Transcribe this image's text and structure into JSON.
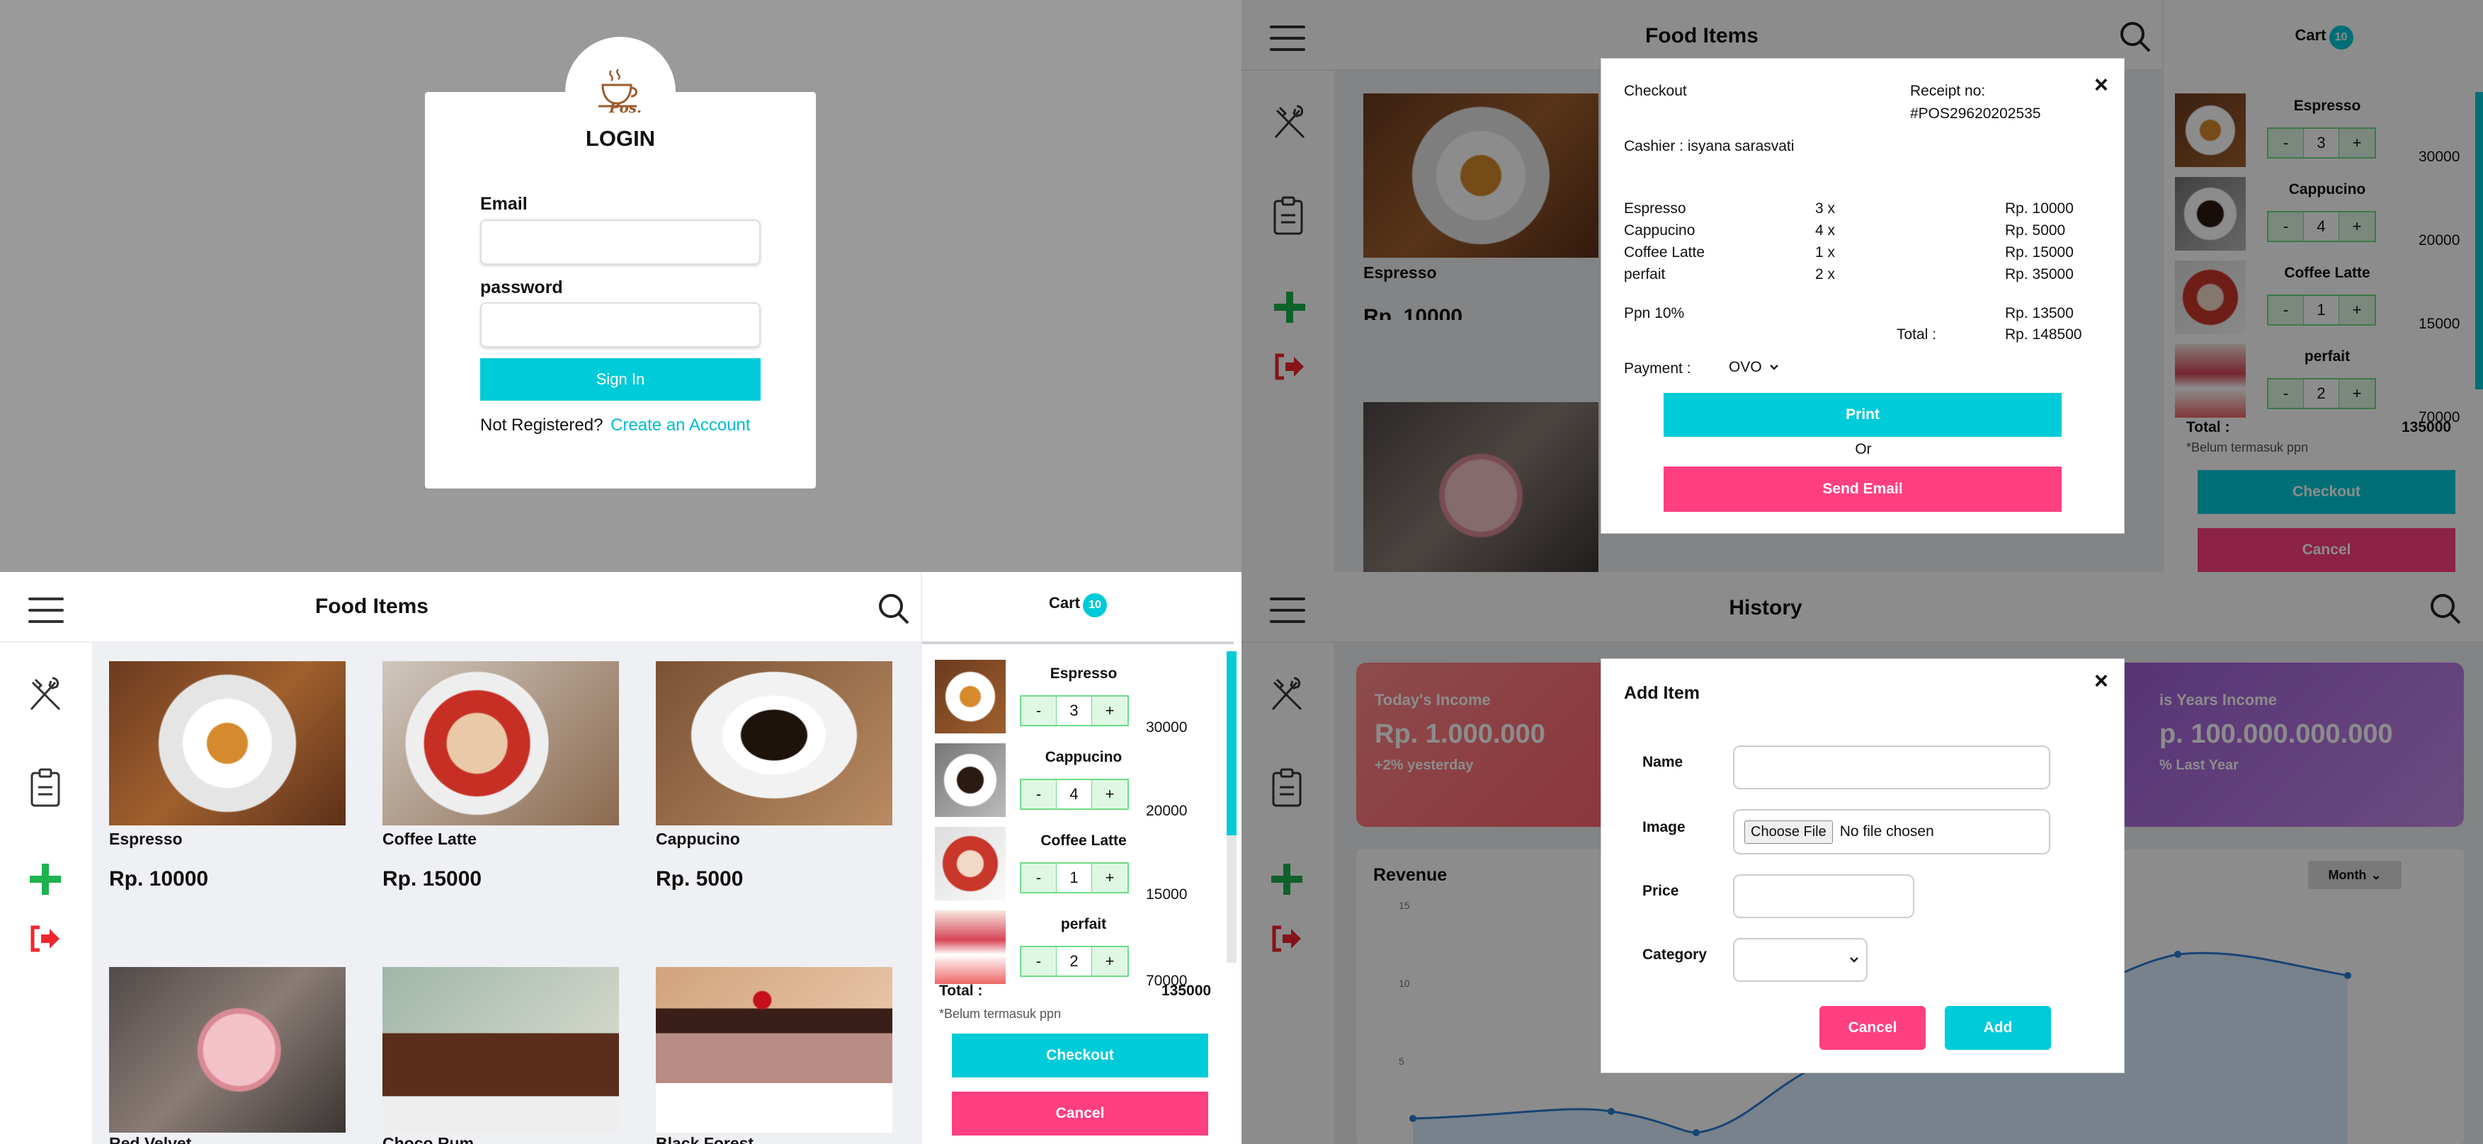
{
  "login": {
    "title": "LOGIN",
    "logo_text": "Pos.",
    "email_label": "Email",
    "password_label": "password",
    "sign_in": "Sign In",
    "not_registered": "Not Registered?",
    "create_account": "Create an Account"
  },
  "pos": {
    "title": "Food Items",
    "cart_label": "Cart",
    "cart_count": "10",
    "foods": [
      {
        "name": "Espresso",
        "price": "Rp. 10000"
      },
      {
        "name": "Coffee Latte",
        "price": "Rp. 15000"
      },
      {
        "name": "Cappucino",
        "price": "Rp. 5000"
      },
      {
        "name": "Red Velvet",
        "price": ""
      },
      {
        "name": "Choco Rum",
        "price": ""
      },
      {
        "name": "Black Forest",
        "price": ""
      }
    ],
    "cart_items": [
      {
        "name": "Espresso",
        "qty": "3",
        "subtotal": "30000"
      },
      {
        "name": "Cappucino",
        "qty": "4",
        "subtotal": "20000"
      },
      {
        "name": "Coffee Latte",
        "qty": "1",
        "subtotal": "15000"
      },
      {
        "name": "perfait",
        "qty": "2",
        "subtotal": "70000"
      }
    ],
    "minus": "-",
    "plus": "+",
    "total_label": "Total :",
    "total_value": "135000",
    "tax_note": "*Belum termasuk ppn",
    "checkout": "Checkout",
    "cancel": "Cancel"
  },
  "checkout_modal": {
    "title": "Checkout",
    "close": "×",
    "receipt_label": "Receipt no:",
    "receipt_no": "#POS29620202535",
    "cashier": "Cashier : isyana sarasvati",
    "lines": [
      {
        "name": "Espresso",
        "qty": "3 x",
        "price": "Rp. 10000"
      },
      {
        "name": "Cappucino",
        "qty": "4 x",
        "price": "Rp. 5000"
      },
      {
        "name": "Coffee Latte",
        "qty": "1 x",
        "price": "Rp. 15000"
      },
      {
        "name": "perfait",
        "qty": "2 x",
        "price": "Rp. 35000"
      }
    ],
    "tax_label": "Ppn 10%",
    "tax_value": "Rp. 13500",
    "total_label": "Total :",
    "total_value": "Rp. 148500",
    "payment_label": "Payment :",
    "payment_value": "OVO",
    "print": "Print",
    "or": "Or",
    "send_email": "Send Email"
  },
  "history": {
    "title": "History",
    "today_label": "Today's Income",
    "today_value": "Rp. 1.000.000",
    "today_delta": "+2% yesterday",
    "year_label": "is Years Income",
    "year_value": "p. 100.000.000.000",
    "year_delta": "% Last Year",
    "revenue": "Revenue",
    "period": "Month",
    "y_ticks": [
      "15",
      "10",
      "5"
    ]
  },
  "add_item_modal": {
    "title": "Add Item",
    "close": "×",
    "name_label": "Name",
    "image_label": "Image",
    "choose_file": "Choose File",
    "no_file": "No file chosen",
    "price_label": "Price",
    "category_label": "Category",
    "cancel": "Cancel",
    "add": "Add"
  },
  "colors": {
    "accent": "#00cbd8",
    "danger": "#ff3f80",
    "add_green": "#1db34f",
    "logout_red": "#f0262e"
  }
}
